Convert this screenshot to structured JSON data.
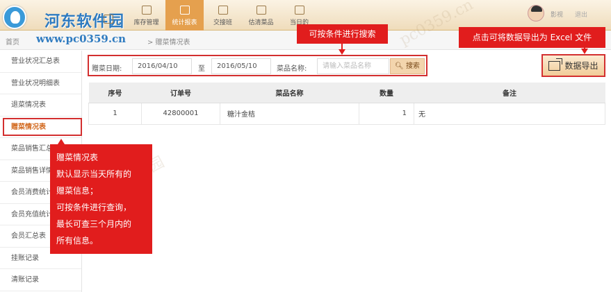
{
  "branding": {
    "logo_text": "河东软件园",
    "site_url": "www.pc0359.cn"
  },
  "nav": [
    {
      "label": "",
      "active": false
    },
    {
      "label": "库存管理",
      "active": false
    },
    {
      "label": "统计报表",
      "active": true
    },
    {
      "label": "交接班",
      "active": false
    },
    {
      "label": "估清菜品",
      "active": false
    },
    {
      "label": "当日的",
      "active": false
    }
  ],
  "user": {
    "name": "影视",
    "extra": "退出"
  },
  "breadcrumb": {
    "home": "首页",
    "current": "> 赠菜情况表"
  },
  "sidebar": [
    {
      "label": "营业状况汇总表",
      "active": false
    },
    {
      "label": "营业状况明细表",
      "active": false
    },
    {
      "label": "退菜情况表",
      "active": false
    },
    {
      "label": "赠菜情况表",
      "active": true
    },
    {
      "label": "菜品销售汇总",
      "active": false
    },
    {
      "label": "菜品销售详情",
      "active": false
    },
    {
      "label": "会员消费统计",
      "active": false
    },
    {
      "label": "会员充值统计",
      "active": false
    },
    {
      "label": "会员汇总表",
      "active": false
    },
    {
      "label": "挂账记录",
      "active": false
    },
    {
      "label": "清账记录",
      "active": false
    }
  ],
  "filter": {
    "date_label": "赠菜日期:",
    "start_date": "2016/04/10",
    "to_label": "至",
    "end_date": "2016/05/10",
    "dish_label": "菜品名称:",
    "dish_placeholder": "请输入菜品名称",
    "search_label": "搜索"
  },
  "export": {
    "label": "数据导出"
  },
  "table": {
    "headers": [
      "序号",
      "订单号",
      "菜品名称",
      "数量",
      "备注"
    ],
    "rows": [
      [
        "1",
        "42800001",
        "糖汁金桔",
        "1",
        "无"
      ]
    ]
  },
  "annotations": {
    "search_hint": "可按条件进行搜索",
    "export_hint": "点击可将数据导出为 Excel 文件",
    "side_lines": [
      "赠菜情况表",
      "默认显示当天所有的",
      "赠菜信息；",
      "可按条件进行查询，",
      "最长可查三个月内的",
      "所有信息。"
    ]
  },
  "colors": {
    "accent": "#e5a04e",
    "annotation": "#e11d1d",
    "brand_blue": "#2f7bc0"
  }
}
